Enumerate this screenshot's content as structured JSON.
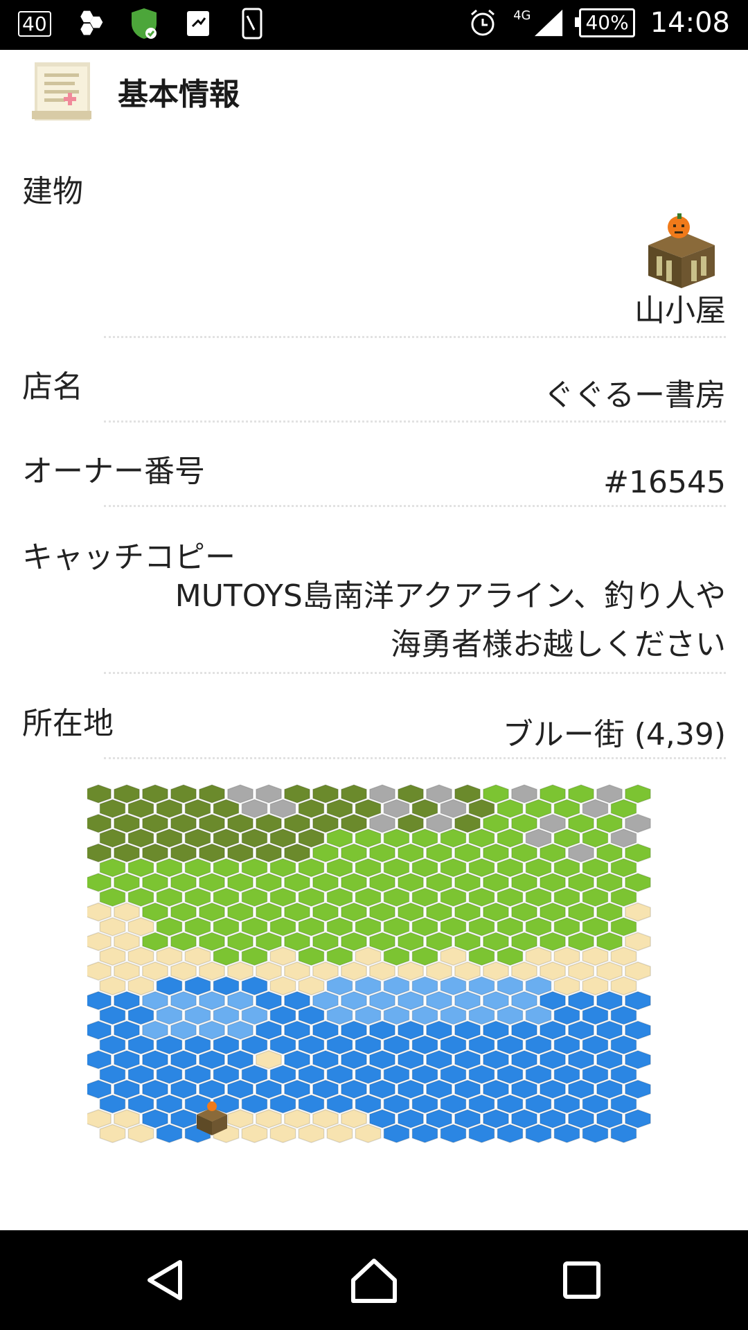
{
  "status_bar": {
    "notif_badge": "40",
    "network": "4G",
    "battery": "40%",
    "time": "14:08",
    "icons": [
      "hexagons-icon",
      "shield-icon",
      "sync-icon",
      "phone-icon",
      "alarm-icon",
      "signal-icon",
      "battery-icon"
    ]
  },
  "header": {
    "title": "基本情報",
    "icon": "scroll-icon"
  },
  "info": {
    "building_label": "建物",
    "building_value": "山小屋",
    "shop_label": "店名",
    "shop_value": "ぐぐるー書房",
    "owner_label": "オーナー番号",
    "owner_value": "#16545",
    "catch_label": "キャッチコピー",
    "catch_line1": "MUTOYS島南洋アクアライン、釣り人や",
    "catch_line2": "海勇者様お越しください",
    "location_label": "所在地",
    "location_value": "ブルー街 (4,39)"
  },
  "map": {
    "name": "hex-map",
    "colors": {
      "forest": "#6b8a2c",
      "grass": "#7cc432",
      "rock": "#a9a9a9",
      "sand": "#f7e3b0",
      "shallow": "#6aaef0",
      "water": "#2b86e3"
    },
    "building_position": {
      "col": 4,
      "row": 22
    }
  },
  "nav_bar": {
    "buttons": [
      "back-icon",
      "home-icon",
      "recents-icon"
    ]
  }
}
